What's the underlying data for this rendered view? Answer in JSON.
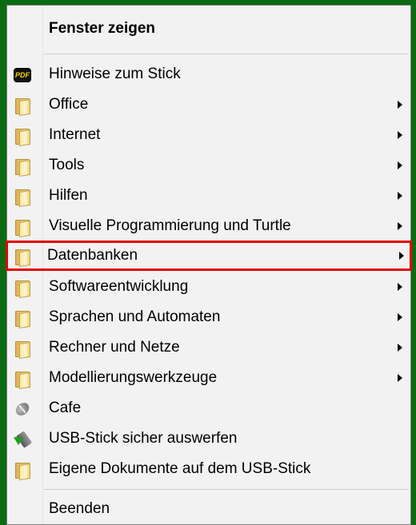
{
  "menu": {
    "header": "Fenster zeigen",
    "items": [
      {
        "label": "Hinweise zum Stick",
        "icon": "pdf-icon",
        "submenu": false
      },
      {
        "label": "Office",
        "icon": "folder-icon",
        "submenu": true
      },
      {
        "label": "Internet",
        "icon": "folder-icon",
        "submenu": true
      },
      {
        "label": "Tools",
        "icon": "folder-icon",
        "submenu": true
      },
      {
        "label": "Hilfen",
        "icon": "folder-icon",
        "submenu": true
      },
      {
        "label": "Visuelle Programmierung und Turtle",
        "icon": "folder-icon",
        "submenu": true
      },
      {
        "label": "Datenbanken",
        "icon": "folder-icon",
        "submenu": true,
        "highlighted": true
      },
      {
        "label": "Softwareentwicklung",
        "icon": "folder-icon",
        "submenu": true
      },
      {
        "label": "Sprachen und Automaten",
        "icon": "folder-icon",
        "submenu": true
      },
      {
        "label": "Rechner und Netze",
        "icon": "folder-icon",
        "submenu": true
      },
      {
        "label": "Modellierungswerkzeuge",
        "icon": "folder-icon",
        "submenu": true
      },
      {
        "label": "Cafe",
        "icon": "coffee-bean-icon",
        "submenu": false
      },
      {
        "label": "USB-Stick sicher auswerfen",
        "icon": "usb-eject-icon",
        "submenu": false
      },
      {
        "label": "Eigene Dokumente auf dem USB-Stick",
        "icon": "folder-icon",
        "submenu": false
      }
    ],
    "footer": "Beenden"
  },
  "colors": {
    "background": "#0c6a13",
    "highlight_border": "#e00000"
  }
}
